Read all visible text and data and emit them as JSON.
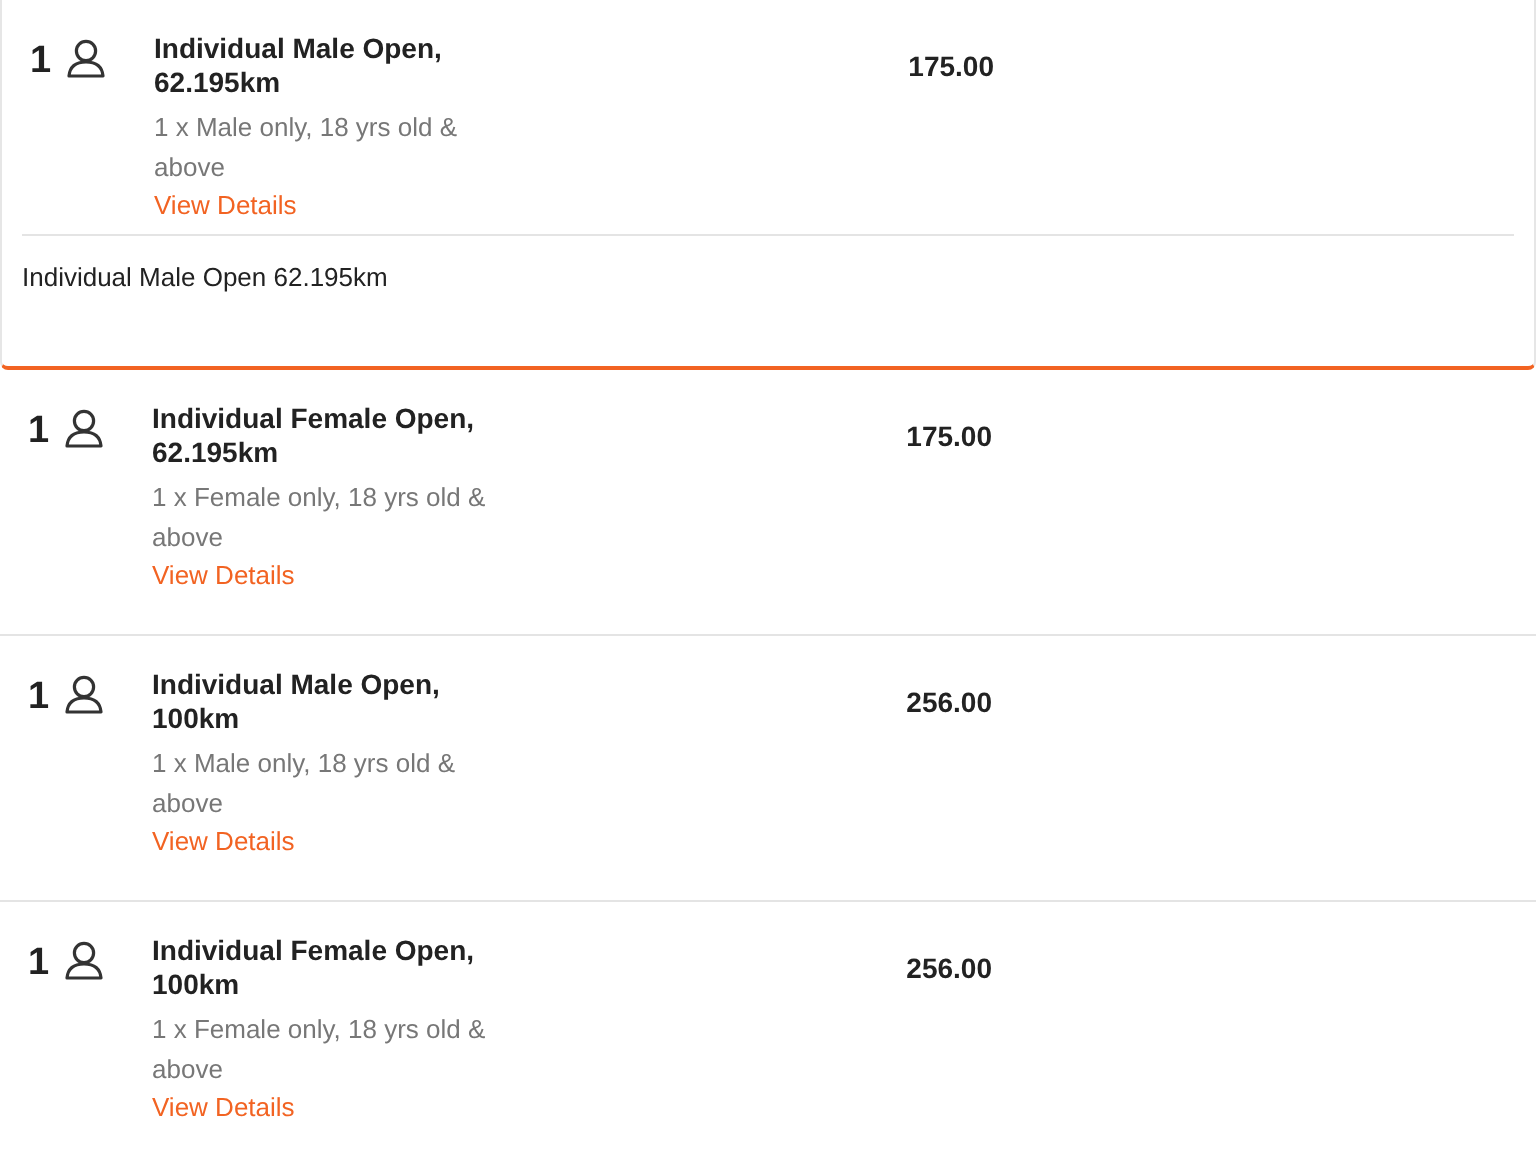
{
  "tickets": [
    {
      "quantity": "1",
      "name": "Individual Male Open, 62.195km",
      "description": "1 x Male only, 18 yrs old & above",
      "link": "View Details",
      "price": "175.00",
      "expanded": true,
      "details": "Individual Male Open 62.195km"
    },
    {
      "quantity": "1",
      "name": "Individual Female Open, 62.195km",
      "description": "1 x Female only, 18 yrs old & above",
      "link": "View Details",
      "price": "175.00",
      "expanded": false
    },
    {
      "quantity": "1",
      "name": "Individual Male Open, 100km",
      "description": "1 x Male only, 18 yrs old & above",
      "link": "View Details",
      "price": "256.00",
      "expanded": false
    },
    {
      "quantity": "1",
      "name": "Individual Female Open, 100km",
      "description": "1 x Female only, 18 yrs old & above",
      "link": "View Details",
      "price": "256.00",
      "expanded": false
    }
  ]
}
